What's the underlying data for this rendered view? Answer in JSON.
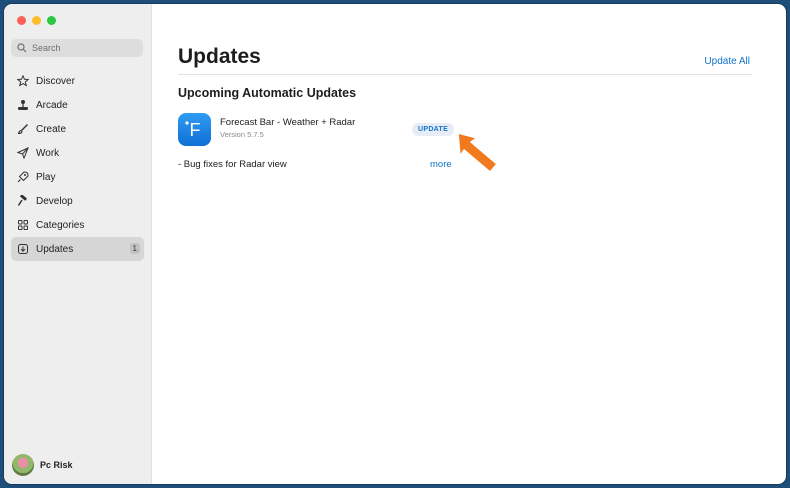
{
  "window": {
    "controls": [
      "close",
      "minimize",
      "zoom"
    ]
  },
  "sidebar": {
    "search": {
      "placeholder": "Search",
      "icon": "search-icon"
    },
    "items": [
      {
        "label": "Discover",
        "icon": "star-icon"
      },
      {
        "label": "Arcade",
        "icon": "joystick-icon"
      },
      {
        "label": "Create",
        "icon": "brush-icon"
      },
      {
        "label": "Work",
        "icon": "paper-plane-icon"
      },
      {
        "label": "Play",
        "icon": "rocket-icon"
      },
      {
        "label": "Develop",
        "icon": "hammer-icon"
      },
      {
        "label": "Categories",
        "icon": "grid-icon"
      },
      {
        "label": "Updates",
        "icon": "download-icon",
        "badge": "1",
        "active": true
      }
    ],
    "user": {
      "name": "Pc Risk"
    }
  },
  "main": {
    "title": "Updates",
    "update_all_label": "Update All",
    "section_title": "Upcoming Automatic Updates",
    "app": {
      "name": "Forecast Bar - Weather + Radar",
      "version": "Version 5.7.5",
      "icon_letter": "F",
      "update_label": "UPDATE",
      "notes": "- Bug fixes for Radar view",
      "more_label": "more"
    }
  },
  "colors": {
    "accent": "#1172c9",
    "sidebar_bg": "#eeeeee",
    "annotation_arrow": "#f07a1d"
  }
}
